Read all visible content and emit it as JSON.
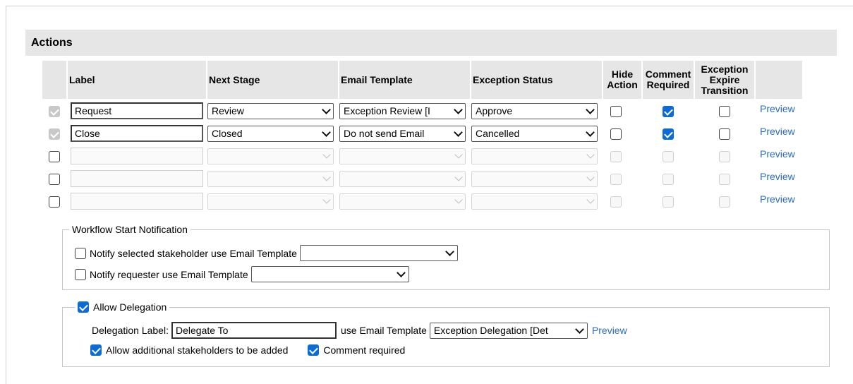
{
  "section": {
    "title": "Actions"
  },
  "columns": {
    "label": "Label",
    "next_stage": "Next Stage",
    "email_template": "Email Template",
    "exception_status": "Exception Status",
    "hide_action": [
      "Hide",
      "Action"
    ],
    "comment_required": [
      "Comment",
      "Required"
    ],
    "expire_transition": [
      "Exception",
      "Expire",
      "Transition"
    ]
  },
  "rows": [
    {
      "enabled": true,
      "row_checked": true,
      "label": "Request",
      "next_stage": "Review",
      "email_template": "Exception Review [I",
      "exception_status": "Approve",
      "hide_action": false,
      "comment_required": true,
      "expire_transition": false,
      "preview": "Preview"
    },
    {
      "enabled": true,
      "row_checked": true,
      "label": "Close",
      "next_stage": "Closed",
      "email_template": "Do not send Email",
      "exception_status": "Cancelled",
      "hide_action": false,
      "comment_required": true,
      "expire_transition": false,
      "preview": "Preview"
    },
    {
      "enabled": false,
      "row_checked": false,
      "label": "",
      "next_stage": "",
      "email_template": "",
      "exception_status": "",
      "hide_action": false,
      "comment_required": false,
      "expire_transition": false,
      "preview": "Preview"
    },
    {
      "enabled": false,
      "row_checked": false,
      "label": "",
      "next_stage": "",
      "email_template": "",
      "exception_status": "",
      "hide_action": false,
      "comment_required": false,
      "expire_transition": false,
      "preview": "Preview"
    },
    {
      "enabled": false,
      "row_checked": false,
      "label": "",
      "next_stage": "",
      "email_template": "",
      "exception_status": "",
      "hide_action": false,
      "comment_required": false,
      "expire_transition": false,
      "preview": "Preview"
    }
  ],
  "workflow_notification": {
    "legend": "Workflow Start Notification",
    "notify_stakeholder_label": "Notify selected stakeholder use Email Template",
    "notify_stakeholder_checked": false,
    "notify_stakeholder_value": "",
    "notify_requester_label": "Notify requester use Email Template",
    "notify_requester_checked": false,
    "notify_requester_value": ""
  },
  "delegation": {
    "legend": "Allow Delegation",
    "allow_checked": true,
    "label_caption": "Delegation Label:",
    "label_value": "Delegate To",
    "template_caption": "use Email Template",
    "template_value": "Exception Delegation [Det",
    "preview": "Preview",
    "additional_label": "Allow additional stakeholders to be added",
    "additional_checked": true,
    "comment_label": "Comment required",
    "comment_checked": true
  },
  "colors": {
    "checkbox_accent": "#0b6cd6",
    "link": "#2a6ebb",
    "header_bg": "#e6e6e6"
  }
}
